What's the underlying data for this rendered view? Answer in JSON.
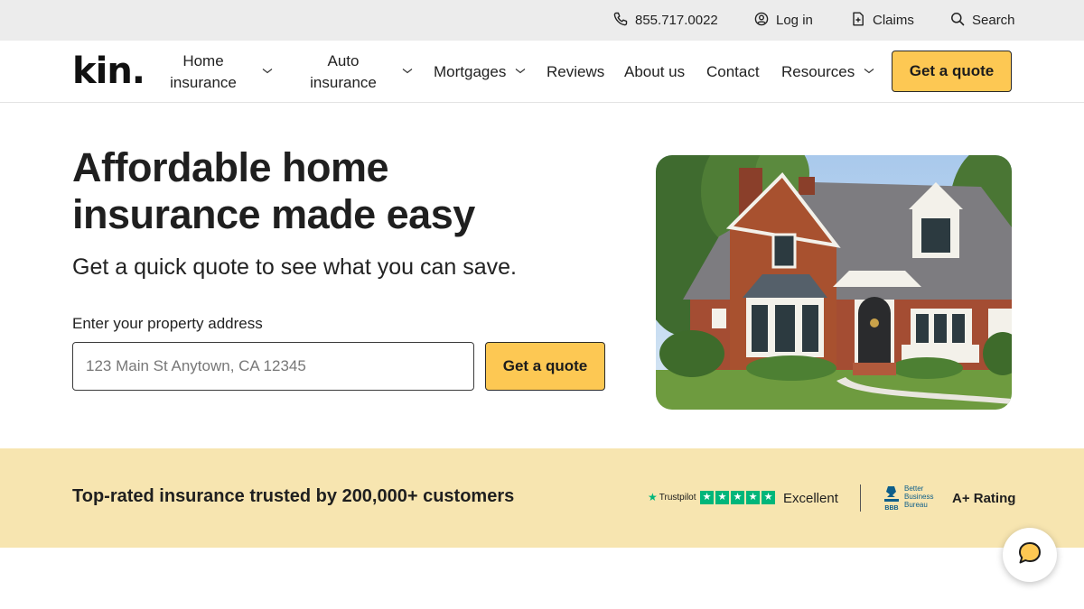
{
  "utility_bar": {
    "phone": "855.717.0022",
    "login": "Log in",
    "claims": "Claims",
    "search": "Search"
  },
  "nav": {
    "logo": "kin.",
    "items": [
      {
        "label": "Home\ninsurance",
        "has_dropdown": true
      },
      {
        "label": "Auto\ninsurance",
        "has_dropdown": true
      },
      {
        "label": "Mortgages",
        "has_dropdown": true
      },
      {
        "label": "Reviews",
        "has_dropdown": false
      },
      {
        "label": "About us",
        "has_dropdown": false
      },
      {
        "label": "Contact",
        "has_dropdown": false
      },
      {
        "label": "Resources",
        "has_dropdown": true
      }
    ],
    "cta_label": "Get a quote"
  },
  "hero": {
    "title": "Affordable home insurance made easy",
    "subtitle": "Get a quick quote to see what you can save.",
    "address_label": "Enter your property address",
    "address_placeholder": "123 Main St Anytown, CA 12345",
    "address_value": "",
    "cta_label": "Get a quote"
  },
  "trust": {
    "headline": "Top-rated insurance trusted by 200,000+ customers",
    "trustpilot_brand": "Trustpilot",
    "trustpilot_rating": "Excellent",
    "trustpilot_stars": 5,
    "bbb_brand_line1": "Better",
    "bbb_brand_line2": "Business",
    "bbb_brand_line3": "Bureau",
    "bbb_rating": "A+ Rating"
  },
  "colors": {
    "accent": "#fdc853",
    "band": "#f7e5b0",
    "utility_bg": "#ececec",
    "trustpilot_green": "#00b67a",
    "bbb_blue": "#0d5e8a"
  },
  "icons": {
    "phone": "phone-icon",
    "login": "user-circle-icon",
    "claims": "file-plus-icon",
    "search": "search-icon",
    "chat": "chat-bubble-icon"
  }
}
